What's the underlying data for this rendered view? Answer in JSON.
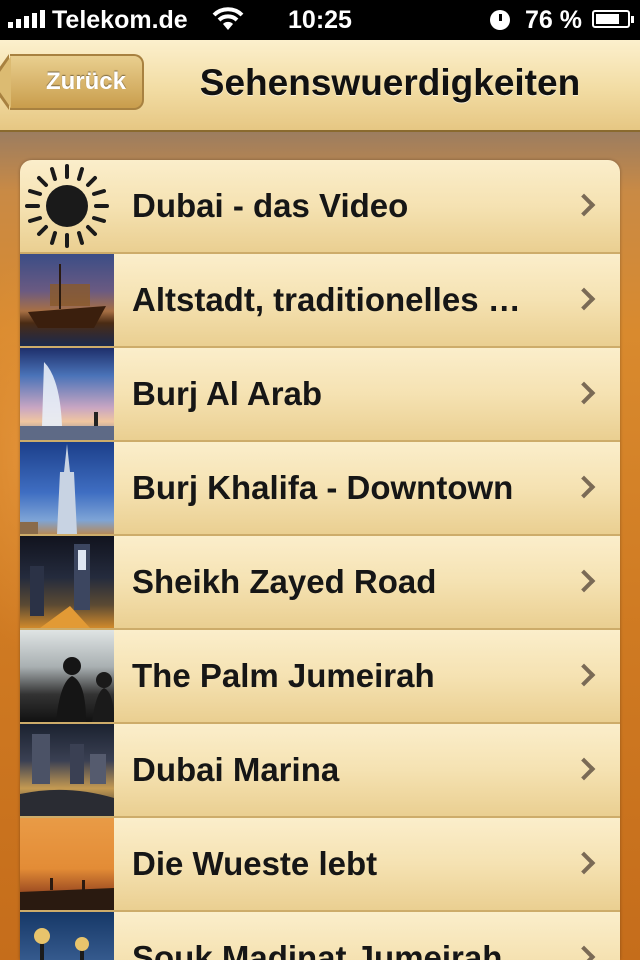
{
  "status_bar": {
    "carrier": "Telekom.de",
    "time": "10:25",
    "battery": "76 %",
    "battery_level": 0.76
  },
  "nav": {
    "back_label": "Zurück",
    "title": "Sehenswuerdigkeiten"
  },
  "list": {
    "items": [
      {
        "label": "Dubai - das Video",
        "icon": "sun-icon"
      },
      {
        "label": "Altstadt, traditionelles …",
        "icon": "dhow-boat-photo"
      },
      {
        "label": "Burj Al Arab",
        "icon": "burj-al-arab-photo"
      },
      {
        "label": "Burj Khalifa - Downtown",
        "icon": "burj-khalifa-photo"
      },
      {
        "label": "Sheikh Zayed Road",
        "icon": "sheikh-zayed-road-photo"
      },
      {
        "label": "The Palm Jumeirah",
        "icon": "palm-jumeirah-photo"
      },
      {
        "label": "Dubai Marina",
        "icon": "dubai-marina-photo"
      },
      {
        "label": "Die Wueste lebt",
        "icon": "desert-photo"
      },
      {
        "label": "Souk Madinat Jumeirah",
        "icon": "souk-photo"
      }
    ]
  }
}
